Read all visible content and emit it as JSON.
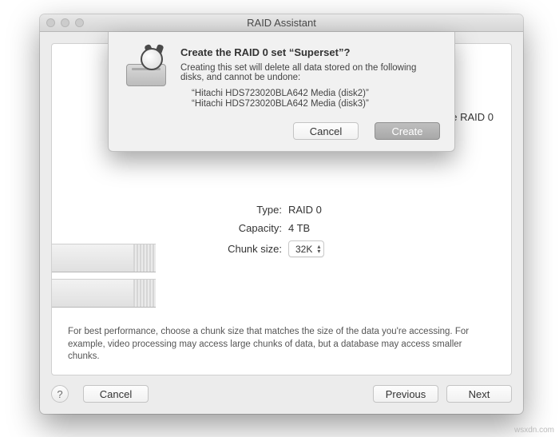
{
  "window": {
    "title": "RAID Assistant"
  },
  "panel": {
    "right_hint_suffix": "e RAID 0",
    "props": {
      "type_label": "Type:",
      "type_value": "RAID 0",
      "capacity_label": "Capacity:",
      "capacity_value": "4 TB",
      "chunk_label": "Chunk size:",
      "chunk_value": "32K"
    },
    "hint": "For best performance, choose a chunk size that matches the size of the data you're accessing. For example, video processing may access large chunks of data, but a database may access smaller chunks."
  },
  "bottombar": {
    "help": "?",
    "cancel": "Cancel",
    "previous": "Previous",
    "next": "Next"
  },
  "sheet": {
    "title": "Create the RAID 0 set “Superset”?",
    "message": "Creating this set will delete all data stored on the following disks, and cannot be undone:",
    "disks": [
      "“Hitachi HDS723020BLA642 Media (disk2)”",
      "“Hitachi HDS723020BLA642 Media (disk3)”"
    ],
    "cancel": "Cancel",
    "create": "Create"
  },
  "watermark": "wsxdn.com"
}
